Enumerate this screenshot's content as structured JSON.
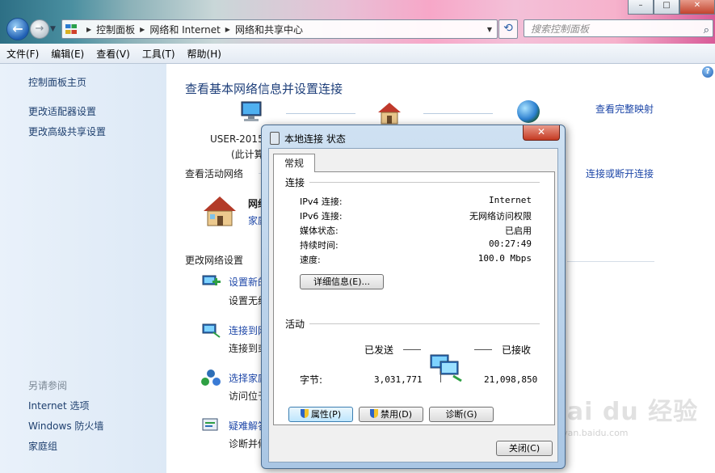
{
  "window": {
    "address_crumbs": [
      "控制面板",
      "网络和 Internet",
      "网络和共享中心"
    ],
    "search_placeholder": "搜索控制面板",
    "controls": {
      "minimize": "–",
      "maximize": "□",
      "close": "✕"
    }
  },
  "menubar": [
    "文件(F)",
    "编辑(E)",
    "查看(V)",
    "工具(T)",
    "帮助(H)"
  ],
  "sidebar": {
    "top_links": [
      "控制面板主页",
      "更改适配器设置",
      "更改高级共享设置"
    ],
    "see_also_heading": "另请参阅",
    "see_also_links": [
      "Internet 选项",
      "Windows 防火墙",
      "家庭组"
    ]
  },
  "main": {
    "title": "查看基本网络信息并设置连接",
    "view_full_map": "查看完整映射",
    "pc_name": "USER-2015",
    "pc_sub": "(此计算",
    "active_networks_label": "查看活动网络",
    "connect_disconnect": "连接或断开连接",
    "active_net_name": "网络",
    "active_net_type": "家庭",
    "change_settings_label": "更改网络设置",
    "tasks": [
      {
        "link": "设置新的",
        "desc": "设置无线"
      },
      {
        "link": "连接到网",
        "desc": "连接到或"
      },
      {
        "link": "选择家庭",
        "desc": "访问位于"
      },
      {
        "link": "疑难解答",
        "desc": "诊断并修"
      }
    ]
  },
  "dialog": {
    "title": "本地连接 状态",
    "close_glyph": "✕",
    "tab": "常规",
    "connection_group": "连接",
    "rows": [
      {
        "key": "IPv4 连接:",
        "value": "Internet"
      },
      {
        "key": "IPv6 连接:",
        "value": "无网络访问权限"
      },
      {
        "key": "媒体状态:",
        "value": "已启用"
      },
      {
        "key": "持续时间:",
        "value": "00:27:49"
      },
      {
        "key": "速度:",
        "value": "100.0 Mbps"
      }
    ],
    "details_button": "详细信息(E)...",
    "activity_group": "活动",
    "sent_label": "已发送",
    "received_label": "已接收",
    "bytes_label": "字节:",
    "bytes_sent": "3,031,771",
    "bytes_received": "21,098,850",
    "properties_button": "属性(P)",
    "disable_button": "禁用(D)",
    "diagnose_button": "诊断(G)",
    "close_button": "关闭(C)"
  },
  "watermark": {
    "logo": "Bai du 经验",
    "url": "jingyan.baidu.com"
  }
}
